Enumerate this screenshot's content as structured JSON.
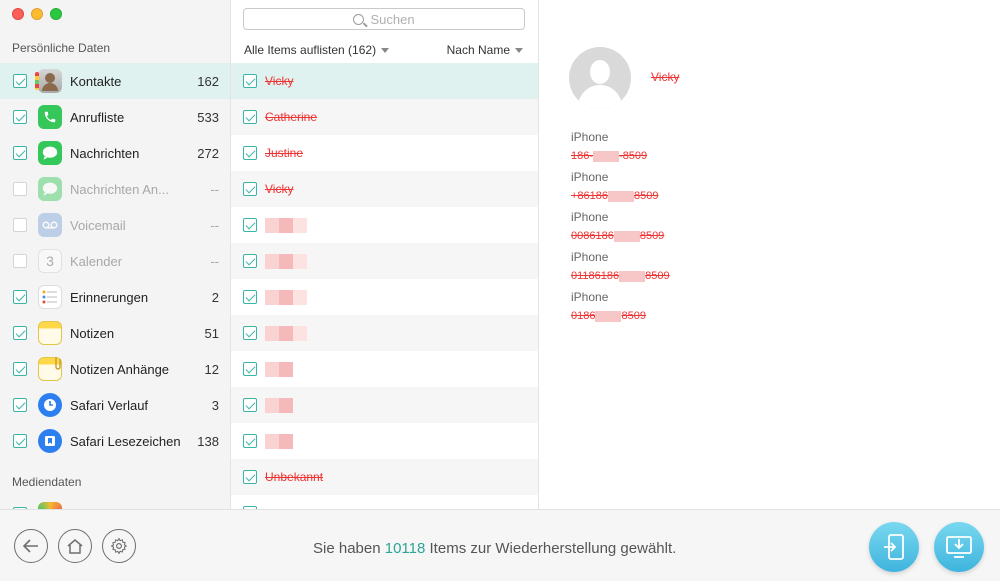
{
  "sidebar": {
    "section_personal": "Persönliche Daten",
    "section_media": "Mediendaten",
    "items": [
      {
        "label": "Kontakte",
        "count": "162",
        "checked": true,
        "icon": "contacts-icon"
      },
      {
        "label": "Anrufliste",
        "count": "533",
        "checked": true,
        "icon": "phone-icon"
      },
      {
        "label": "Nachrichten",
        "count": "272",
        "checked": true,
        "icon": "messages-icon"
      },
      {
        "label": "Nachrichten An...",
        "count": "--",
        "checked": false,
        "icon": "message-attachments-icon"
      },
      {
        "label": "Voicemail",
        "count": "--",
        "checked": false,
        "icon": "voicemail-icon"
      },
      {
        "label": "Kalender",
        "count": "--",
        "checked": false,
        "icon": "calendar-icon"
      },
      {
        "label": "Erinnerungen",
        "count": "2",
        "checked": true,
        "icon": "reminders-icon"
      },
      {
        "label": "Notizen",
        "count": "51",
        "checked": true,
        "icon": "notes-icon"
      },
      {
        "label": "Notizen Anhänge",
        "count": "12",
        "checked": true,
        "icon": "note-attachments-icon"
      },
      {
        "label": "Safari Verlauf",
        "count": "3",
        "checked": true,
        "icon": "safari-history-icon"
      },
      {
        "label": "Safari Lesezeichen",
        "count": "138",
        "checked": true,
        "icon": "safari-bookmarks-icon"
      }
    ],
    "calendar_day": "3"
  },
  "middle": {
    "search_placeholder": "Suchen",
    "filter_label": "Alle Items auflisten (162)",
    "sort_label": "Nach Name",
    "rows": [
      "Vicky",
      "Catherine",
      "Justine",
      "Vicky",
      "",
      "",
      "",
      "",
      "",
      "",
      "",
      "Unbekannt"
    ]
  },
  "detail": {
    "name": "Vicky",
    "phones": [
      {
        "label": "iPhone",
        "prefix": "186-",
        "suffix": "-8509"
      },
      {
        "label": "iPhone",
        "prefix": "+86186",
        "suffix": "8509"
      },
      {
        "label": "iPhone",
        "prefix": "0086186",
        "suffix": "8509"
      },
      {
        "label": "iPhone",
        "prefix": "01186186",
        "suffix": "8509"
      },
      {
        "label": "iPhone",
        "prefix": "0186",
        "suffix": "8509"
      }
    ]
  },
  "footer": {
    "status_prefix": "Sie haben",
    "status_count": "10118",
    "status_suffix": "Items zur Wiederherstellung gewählt."
  },
  "colors": {
    "accent": "#3ab5a5",
    "deleted": "#e33333",
    "button": "#3eb4dd"
  }
}
